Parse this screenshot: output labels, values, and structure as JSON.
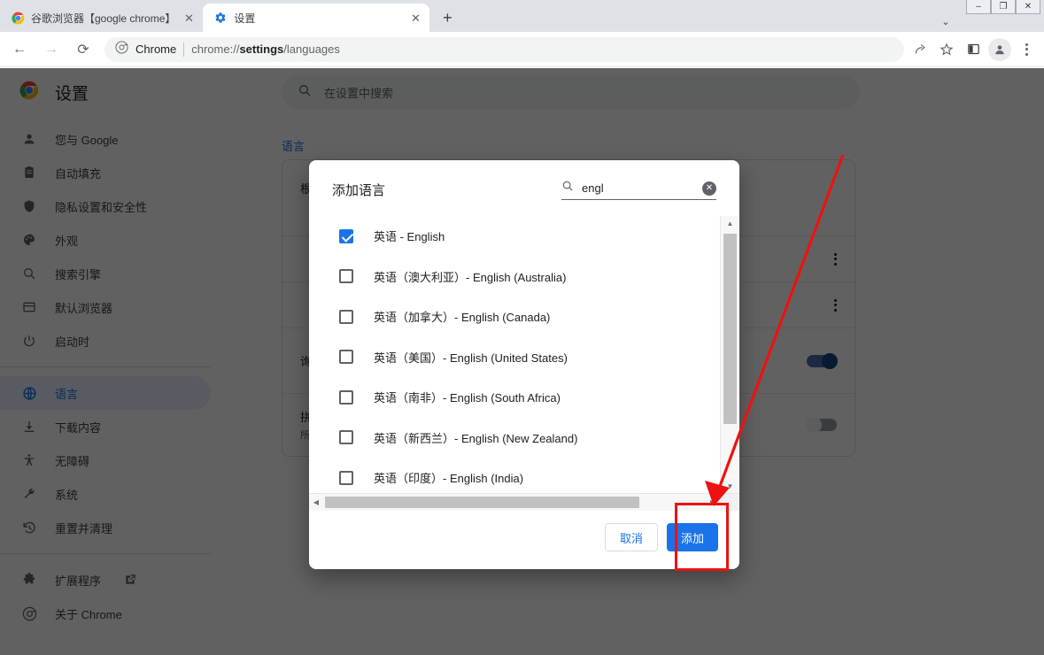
{
  "window": {
    "controls": [
      {
        "name": "minimize",
        "glyph": "–"
      },
      {
        "name": "maximize",
        "glyph": "❐"
      },
      {
        "name": "close",
        "glyph": "✕"
      }
    ]
  },
  "tabs": [
    {
      "title": "谷歌浏览器【google chrome】",
      "favicon": "chrome-icon",
      "active": false,
      "close_label": "✕"
    },
    {
      "title": "设置",
      "favicon": "gear-icon",
      "active": true,
      "close_label": "✕"
    }
  ],
  "tabstrip": {
    "new_tab_label": "+",
    "tab_list_chevron": "⌄"
  },
  "toolbar": {
    "back_label": "←",
    "forward_label": "→",
    "reload_label": "⟳",
    "chrome_label": "Chrome",
    "url_prefix": "chrome://",
    "url_bold": "settings",
    "url_suffix": "/languages",
    "icons": [
      {
        "name": "share-icon",
        "glyph": "↗"
      },
      {
        "name": "bookmark-star-icon",
        "glyph": "☆"
      },
      {
        "name": "side-panel-icon",
        "glyph": "◫"
      },
      {
        "name": "profile-avatar-icon",
        "glyph": "●"
      },
      {
        "name": "chrome-menu-icon",
        "glyph": "⋮"
      }
    ]
  },
  "settings": {
    "brand_title": "设置",
    "search_placeholder": "在设置中搜索",
    "nav_items": [
      {
        "label": "您与 Google",
        "icon": "person-icon",
        "selected": false
      },
      {
        "label": "自动填充",
        "icon": "autofill-icon",
        "selected": false
      },
      {
        "label": "隐私设置和安全性",
        "icon": "shield-icon",
        "selected": false
      },
      {
        "label": "外观",
        "icon": "palette-icon",
        "selected": false
      },
      {
        "label": "搜索引擎",
        "icon": "search-icon",
        "selected": false
      },
      {
        "label": "默认浏览器",
        "icon": "browser-icon",
        "selected": false
      },
      {
        "label": "启动时",
        "icon": "power-icon",
        "selected": false
      }
    ],
    "nav_items_two": [
      {
        "label": "语言",
        "icon": "globe-icon",
        "selected": true
      },
      {
        "label": "下载内容",
        "icon": "download-icon",
        "selected": false
      },
      {
        "label": "无障碍",
        "icon": "accessibility-icon",
        "selected": false
      },
      {
        "label": "系统",
        "icon": "wrench-icon",
        "selected": false
      },
      {
        "label": "重置并清理",
        "icon": "restore-icon",
        "selected": false
      }
    ],
    "nav_items_three": [
      {
        "label": "扩展程序",
        "icon": "puzzle-icon",
        "external": true,
        "selected": false
      },
      {
        "label": "关于 Chrome",
        "icon": "chrome-icon",
        "external": false,
        "selected": false
      }
    ],
    "section_title": "语言",
    "card_rows": [
      {
        "label": "根",
        "sub": "",
        "control": "none"
      },
      {
        "label": "",
        "sub": "",
        "control": "dots"
      },
      {
        "label": "",
        "sub": "",
        "control": "dots"
      },
      {
        "label": "询",
        "sub": "",
        "control": "toggle-on"
      },
      {
        "label": "拼",
        "sub": "所",
        "control": "toggle-off"
      }
    ]
  },
  "dialog": {
    "title": "添加语言",
    "search_value": "engl",
    "search_icon": "search-icon",
    "clear_label": "✕",
    "languages": [
      {
        "label": "英语 - English",
        "checked": true
      },
      {
        "label": "英语（澳大利亚）- English (Australia)",
        "checked": false
      },
      {
        "label": "英语（加拿大）- English (Canada)",
        "checked": false
      },
      {
        "label": "英语（美国）- English (United States)",
        "checked": false
      },
      {
        "label": "英语（南非）- English (South Africa)",
        "checked": false
      },
      {
        "label": "英语（新西兰）- English (New Zealand)",
        "checked": false
      },
      {
        "label": "英语（印度）- English (India)",
        "checked": false
      }
    ],
    "scroll": {
      "up_arrow": "▲",
      "down_arrow": "▼",
      "left_arrow": "◀",
      "right_arrow": "▶"
    },
    "cancel_label": "取消",
    "add_label": "添加"
  },
  "annotation": {
    "highlight_color": "#ee1111",
    "arrow_color": "#ee1111"
  }
}
